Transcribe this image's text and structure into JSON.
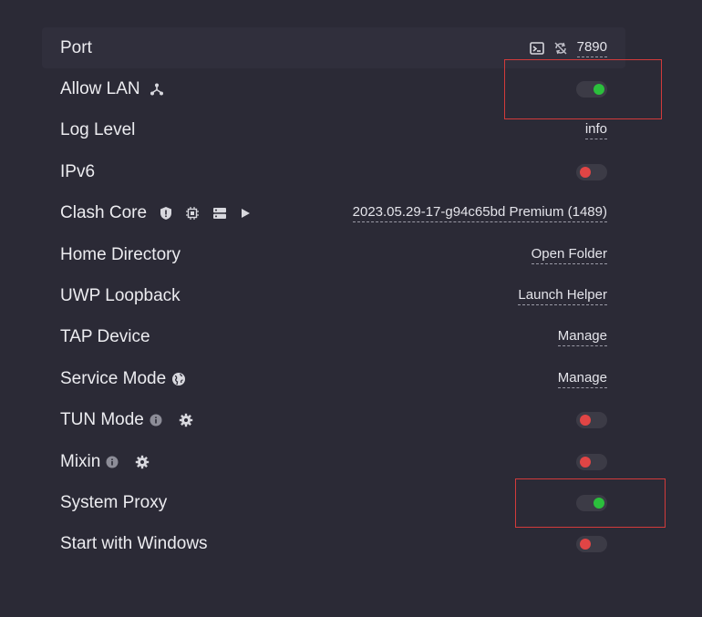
{
  "settings": {
    "port": {
      "label": "Port",
      "value": "7890",
      "icons": [
        "terminal-icon",
        "sync-disabled-icon"
      ]
    },
    "allow_lan": {
      "label": "Allow LAN",
      "enabled": true,
      "icon": "network-icon"
    },
    "log_level": {
      "label": "Log Level",
      "value": "info"
    },
    "ipv6": {
      "label": "IPv6",
      "enabled": false
    },
    "clash_core": {
      "label": "Clash Core",
      "value": "2023.05.29-17-g94c65bd Premium (1489)",
      "icons": [
        "shield-icon",
        "chip-icon",
        "server-icon",
        "play-icon"
      ]
    },
    "home_directory": {
      "label": "Home Directory",
      "action": "Open Folder"
    },
    "uwp_loopback": {
      "label": "UWP Loopback",
      "action": "Launch Helper"
    },
    "tap_device": {
      "label": "TAP Device",
      "action": "Manage"
    },
    "service_mode": {
      "label": "Service Mode",
      "action": "Manage",
      "icon": "globe-icon"
    },
    "tun_mode": {
      "label": "TUN Mode",
      "enabled": false,
      "icons": [
        "info-icon",
        "gear-icon"
      ]
    },
    "mixin": {
      "label": "Mixin",
      "enabled": false,
      "icons": [
        "info-icon",
        "gear-icon"
      ]
    },
    "system_proxy": {
      "label": "System Proxy",
      "enabled": true
    },
    "start_with_windows": {
      "label": "Start with Windows",
      "enabled": false
    }
  },
  "colors": {
    "background": "#2b2a36",
    "toggle_on": "#2bbf3c",
    "toggle_off": "#e04545",
    "annotation_box": "#d23b3b"
  }
}
